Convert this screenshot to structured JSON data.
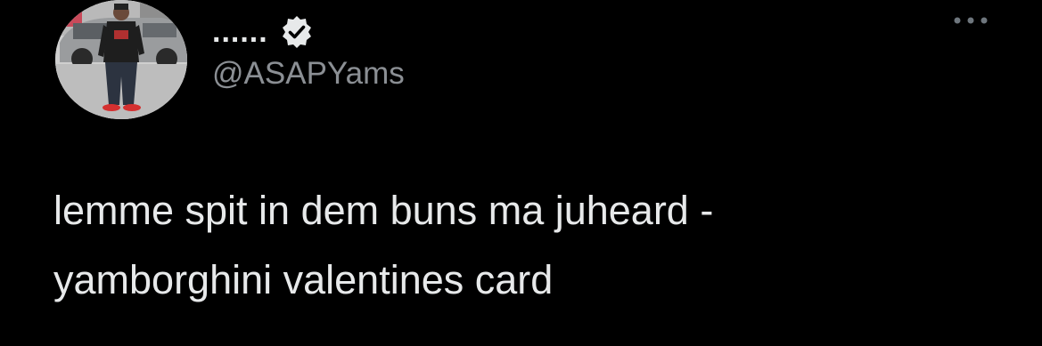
{
  "tweet": {
    "author": {
      "display_name": "......",
      "handle": "@ASAPYams",
      "verified": true,
      "verified_icon": "verified-badge-icon"
    },
    "more_icon": "more-horizontal-icon",
    "text_lines": [
      "lemme spit in dem buns ma juheard -",
      "yamborghini valentines card"
    ]
  },
  "colors": {
    "background": "#000000",
    "primary_text": "#e7e9ea",
    "secondary_text": "#8b8f94"
  }
}
